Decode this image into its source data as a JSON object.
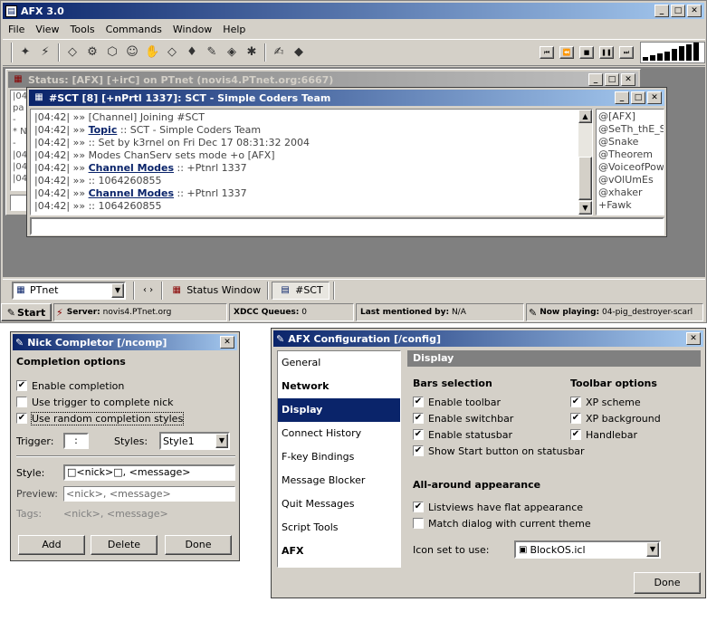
{
  "app": {
    "title": "AFX 3.0"
  },
  "menu": [
    "File",
    "View",
    "Tools",
    "Commands",
    "Window",
    "Help"
  ],
  "toolbar": {
    "icons": [
      "connect-icon",
      "disconnect-icon",
      "channel-icon",
      "query-icon",
      "dcc-icon",
      "folder-icon",
      "hand-icon",
      "ignore-icon",
      "away-icon",
      "script-icon",
      "log-icon",
      "settings-icon",
      "notepad-icon",
      "font-icon"
    ],
    "media_icons": [
      "prev-icon",
      "rewind-icon",
      "stop-icon",
      "pause-icon",
      "next-icon"
    ]
  },
  "status_window": {
    "title": "Status: [AFX] [+irC] on PTnet (novis4.PTnet.org:6667)",
    "lines": [
      "|04",
      "pa",
      "-",
      "* N",
      "-",
      "|04",
      "|04",
      "|04"
    ]
  },
  "channel_window": {
    "title": "#SCT [8] [+nPrtl 1337]: SCT - Simple Coders Team",
    "lines": [
      {
        "ts": "|04:42| »»",
        "text": "[Channel]  Joining #SCT",
        "link": ""
      },
      {
        "ts": "|04:42| »»",
        "link": "Topic",
        "text": ":: SCT - Simple Coders Team"
      },
      {
        "ts": "|04:42| »»",
        "text": ":: Set by  k3rnel on Fri Dec 17 08:31:32 2004",
        "link": ""
      },
      {
        "ts": "|04:42| »»",
        "text": "Modes  ChanServ sets mode  +o [AFX]",
        "link": ""
      },
      {
        "ts": "|04:42| »»",
        "link": "Channel Modes",
        "text": ":: +Ptnrl 1337"
      },
      {
        "ts": "|04:42| »»",
        "text": ":: 1064260855",
        "link": ""
      },
      {
        "ts": "|04:42| »»",
        "link": "Channel Modes",
        "text": ":: +Ptnrl 1337"
      },
      {
        "ts": "|04:42| »»",
        "text": ":: 1064260855",
        "link": ""
      }
    ],
    "nicks": [
      "@[AFX]",
      "@SeTh_thE_S",
      "@Snake",
      "@Theorem",
      "@VoiceofPowe",
      "@vOlUmEs",
      "@xhaker",
      "+Fawk"
    ]
  },
  "switchbar": {
    "network": "PTnet",
    "items": [
      "Status Window",
      "#SCT"
    ]
  },
  "statusbar": {
    "start": "Start",
    "server_label": "Server:",
    "server": "novis4.PTnet.org",
    "xdcc_label": "XDCC Queues:",
    "xdcc": "0",
    "mentioned_label": "Last mentioned by:",
    "mentioned": "N/A",
    "playing_label": "Now playing:",
    "playing": "04-pig_destroyer-scarl"
  },
  "nick_completor": {
    "title": "Nick Completor [/ncomp]",
    "section": "Completion options",
    "options": [
      {
        "label": "Enable completion",
        "checked": "✔"
      },
      {
        "label": "Use trigger to complete nick",
        "checked": ""
      },
      {
        "label": "Use random completion styles",
        "checked": "✔"
      }
    ],
    "trigger_label": "Trigger:",
    "trigger": ":",
    "styles_label": "Styles:",
    "style_selected": "Style1",
    "style_label": "Style:",
    "style_value": "□<nick>□, <message>",
    "preview_label": "Preview:",
    "preview": "<nick>, <message>",
    "tags_label": "Tags:",
    "tags": "<nick>, <message>",
    "buttons": {
      "add": "Add",
      "delete": "Delete",
      "done": "Done"
    }
  },
  "config": {
    "title": "AFX Configuration [/config]",
    "nav": [
      {
        "label": "General",
        "bold": false
      },
      {
        "label": "Network",
        "bold": true
      },
      {
        "label": "Display",
        "bold": true
      },
      {
        "label": "Connect History",
        "bold": false
      },
      {
        "label": "F-key Bindings",
        "bold": false
      },
      {
        "label": "Message Blocker",
        "bold": false
      },
      {
        "label": "Quit Messages",
        "bold": false
      },
      {
        "label": "Script Tools",
        "bold": false
      },
      {
        "label": "AFX",
        "bold": true
      }
    ],
    "selected": "Display",
    "header": "Display",
    "bars_title": "Bars selection",
    "bars": [
      {
        "label": "Enable toolbar",
        "checked": "✔"
      },
      {
        "label": "Enable switchbar",
        "checked": "✔"
      },
      {
        "label": "Enable statusbar",
        "checked": "✔"
      },
      {
        "label": "Show Start button on statusbar",
        "checked": "✔"
      }
    ],
    "toolbar_title": "Toolbar options",
    "toolbar_opts": [
      {
        "label": "XP scheme",
        "checked": "✔"
      },
      {
        "label": "XP background",
        "checked": "✔"
      },
      {
        "label": "Handlebar",
        "checked": "✔"
      }
    ],
    "appearance_title": "All-around appearance",
    "appearance": [
      {
        "label": "Listviews have flat appearance",
        "checked": "✔"
      },
      {
        "label": "Match dialog with current theme",
        "checked": ""
      }
    ],
    "iconset_label": "Icon set to use:",
    "iconset": "BlockOS.icl",
    "done": "Done"
  },
  "colors": {
    "titlebar": "#0a246a",
    "face": "#d4d0c8",
    "workspace": "#808080",
    "selected": "#0a246a"
  }
}
